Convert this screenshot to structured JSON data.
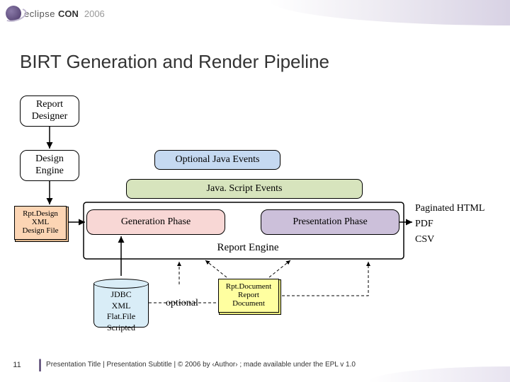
{
  "header": {
    "brand_prefix": "eclipse",
    "brand_suffix": "CON",
    "year": "2006"
  },
  "title": "BIRT Generation and Render Pipeline",
  "nodes": {
    "report_designer": "Report\nDesigner",
    "design_engine": "Design\nEngine",
    "java_events": "Optional Java Events",
    "js_events": "Java. Script Events",
    "generation": "Generation Phase",
    "presentation": "Presentation Phase",
    "report_engine": "Report Engine",
    "rpt_design": "Rpt.Design\nXML\nDesign File",
    "datasources": "JDBC\nXML\nFlat.File\nScripted",
    "optional": "optional",
    "rpt_document": "Rpt.Document\nReport\nDocument"
  },
  "outputs": {
    "html": "Paginated HTML",
    "pdf": "PDF",
    "csv": "CSV"
  },
  "footer": {
    "page": "11",
    "text": "Presentation Title  |  Presentation Subtitle  |  © 2006 by ‹Author› ; made available under the EPL v 1.0"
  }
}
